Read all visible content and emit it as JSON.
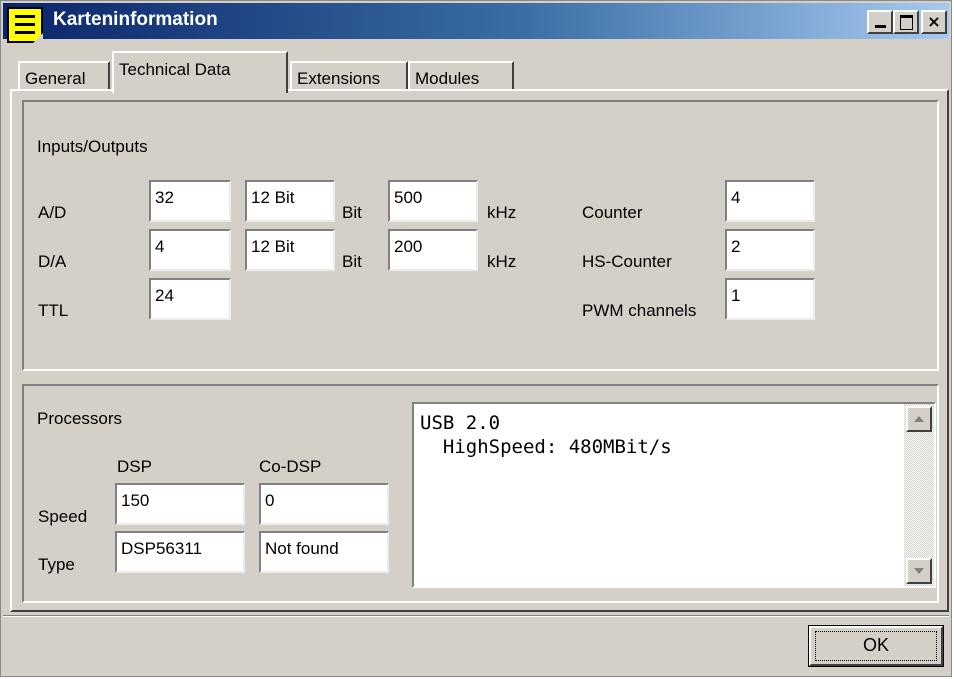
{
  "window": {
    "title": "Karteninformation",
    "titlebar_color": "#0a246a"
  },
  "title_buttons": {
    "minimize": "minimize-button",
    "maximize": "maximize-button",
    "close": "×"
  },
  "tabs": [
    {
      "label": "General",
      "active": false
    },
    {
      "label": "Technical Data",
      "active": true
    },
    {
      "label": "Extensions",
      "active": false
    },
    {
      "label": "Modules",
      "active": false
    }
  ],
  "io": {
    "group_label": "Inputs/Outputs",
    "rows": [
      {
        "label": "A/D",
        "count": "32",
        "bits": "12 Bit",
        "bit_unit": "Bit",
        "freq": "500",
        "freq_unit": "kHz"
      },
      {
        "label": "D/A",
        "count": "4",
        "bits": "12 Bit",
        "bit_unit": "Bit",
        "freq": "200",
        "freq_unit": "kHz"
      },
      {
        "label": "TTL",
        "count": "24"
      }
    ],
    "counters": [
      {
        "label": "Counter",
        "value": "4"
      },
      {
        "label": "HS-Counter",
        "value": "2"
      },
      {
        "label": "PWM channels",
        "value": "1"
      }
    ]
  },
  "processors": {
    "group_label": "Processors",
    "col_dsp": "DSP",
    "col_codsp": "Co-DSP",
    "speed_label": "Speed",
    "type_label": "Type",
    "dsp_speed": "150",
    "codsp_speed": "0",
    "dsp_type": "DSP56311",
    "codsp_type": "Not found"
  },
  "memo": {
    "text": "USB 2.0\n  HighSpeed: 480MBit/s"
  },
  "ok_button": {
    "label": "OK"
  }
}
